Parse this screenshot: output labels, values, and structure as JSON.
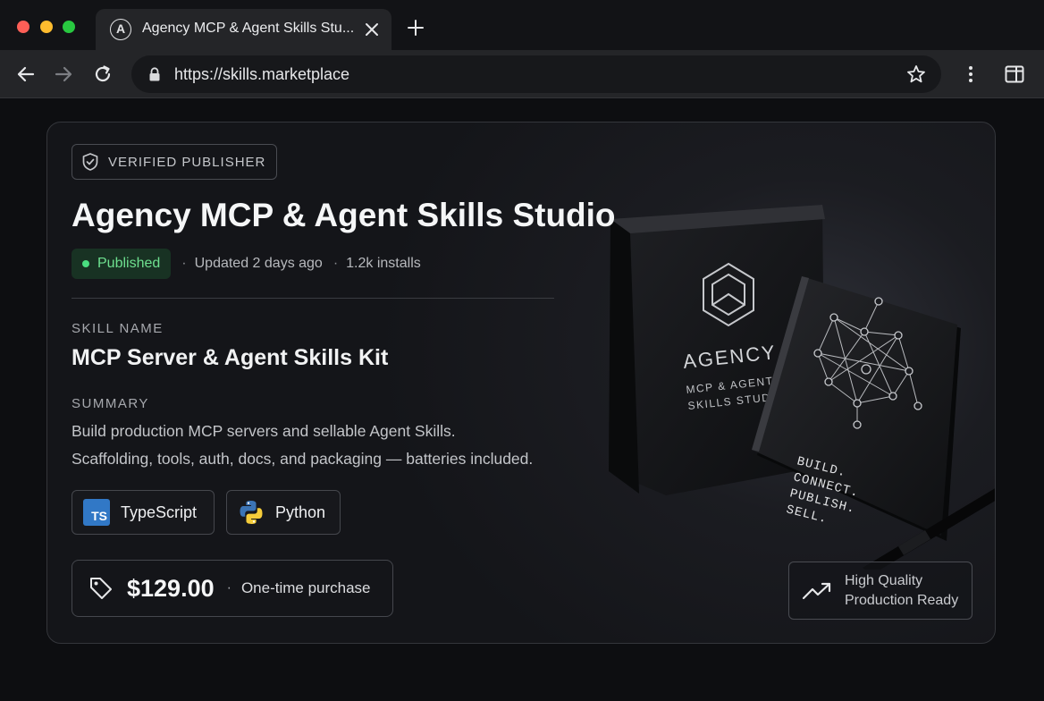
{
  "browser": {
    "tab_title": "Agency MCP & Agent Skills Stu...",
    "tab_favicon_letter": "A",
    "url": "https://skills.marketplace"
  },
  "listing": {
    "verified_badge": "VERIFIED PUBLISHER",
    "title": "Agency MCP & Agent Skills Studio",
    "status": "Published",
    "updated": "Updated 2 days ago",
    "installs": "1.2k installs",
    "meta_separator": "·",
    "skill_name_label": "SKILL NAME",
    "skill_name": "MCP Server & Agent Skills Kit",
    "summary_label": "SUMMARY",
    "summary_line_1": "Build production MCP servers and sellable Agent Skills.",
    "summary_line_2": "Scaffolding, tools, auth, docs, and packaging — batteries included.",
    "languages": [
      {
        "name": "TypeScript",
        "logo_text": "TS",
        "icon": "typescript-icon"
      },
      {
        "name": "Python",
        "icon": "python-icon"
      }
    ],
    "price": "$129.00",
    "price_note": "One-time purchase",
    "quality_line_1": "High Quality",
    "quality_line_2": "Production Ready"
  },
  "product_image": {
    "box_brand": "AGENCY",
    "box_line_1": "MCP & AGENT",
    "box_line_2": "SKILLS STUDIO",
    "notebook_lines": [
      "BUILD.",
      "CONNECT.",
      "PUBLISH.",
      "SELL."
    ]
  },
  "colors": {
    "accent_green": "#4ade80",
    "typescript_blue": "#3178c6",
    "python_blue": "#3b74b5",
    "python_yellow": "#f5cc3a"
  }
}
